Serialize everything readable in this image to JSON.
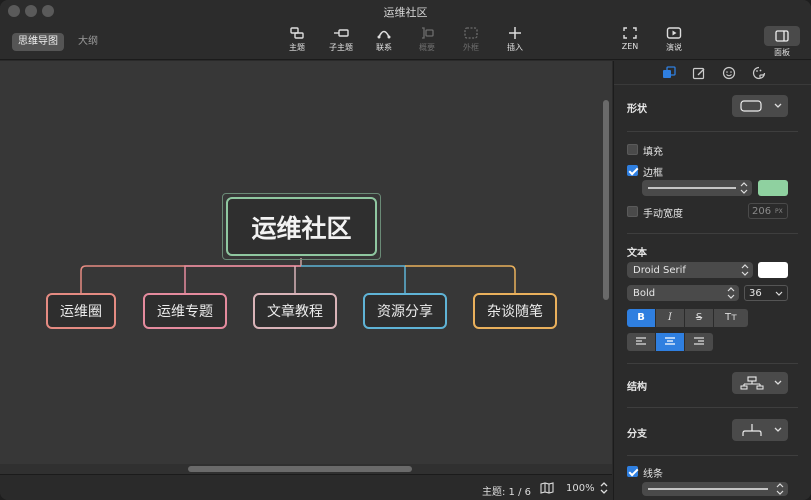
{
  "window": {
    "title": "运维社区"
  },
  "toolbar": {
    "view_modes": [
      "思维导图",
      "大纲"
    ],
    "tools": [
      {
        "label": "主题",
        "icon": "topic-icon",
        "enabled": true
      },
      {
        "label": "子主题",
        "icon": "subtopic-icon",
        "enabled": true
      },
      {
        "label": "联系",
        "icon": "relationship-icon",
        "enabled": true
      },
      {
        "label": "概要",
        "icon": "summary-icon",
        "enabled": false
      },
      {
        "label": "外框",
        "icon": "boundary-icon",
        "enabled": false
      },
      {
        "label": "插入",
        "icon": "plus-icon",
        "enabled": true
      },
      {
        "label": "ZEN",
        "icon": "zen-icon",
        "enabled": true
      },
      {
        "label": "演说",
        "icon": "present-icon",
        "enabled": true
      }
    ],
    "panel_label": "面板"
  },
  "mindmap": {
    "root": "运维社区",
    "children": [
      {
        "label": "运维圈",
        "color": "#e58b82"
      },
      {
        "label": "运维专题",
        "color": "#e58b9e"
      },
      {
        "label": "文章教程",
        "color": "#d9b3b8"
      },
      {
        "label": "资源分享",
        "color": "#5fb3d6"
      },
      {
        "label": "杂谈随笔",
        "color": "#e9b05c"
      }
    ],
    "root_color": "#8fc7a0"
  },
  "status": {
    "topic_count": "主题: 1 / 6",
    "zoom": "100%"
  },
  "panel": {
    "shape_title": "形状",
    "fill_label": "填充",
    "fill_checked": false,
    "border_label": "边框",
    "border_checked": true,
    "border_color": "#8fd1a0",
    "manual_width_label": "手动宽度",
    "manual_width_checked": false,
    "manual_width_value": "206",
    "manual_width_unit": "PX",
    "text_title": "文本",
    "font_family": "Droid Serif",
    "font_weight": "Bold",
    "font_size": "36",
    "text_color": "#ffffff",
    "style_buttons": [
      "B",
      "I",
      "S",
      "Tт"
    ],
    "structure_title": "结构",
    "branch_title": "分支",
    "line_label": "线条",
    "line_checked": true
  }
}
